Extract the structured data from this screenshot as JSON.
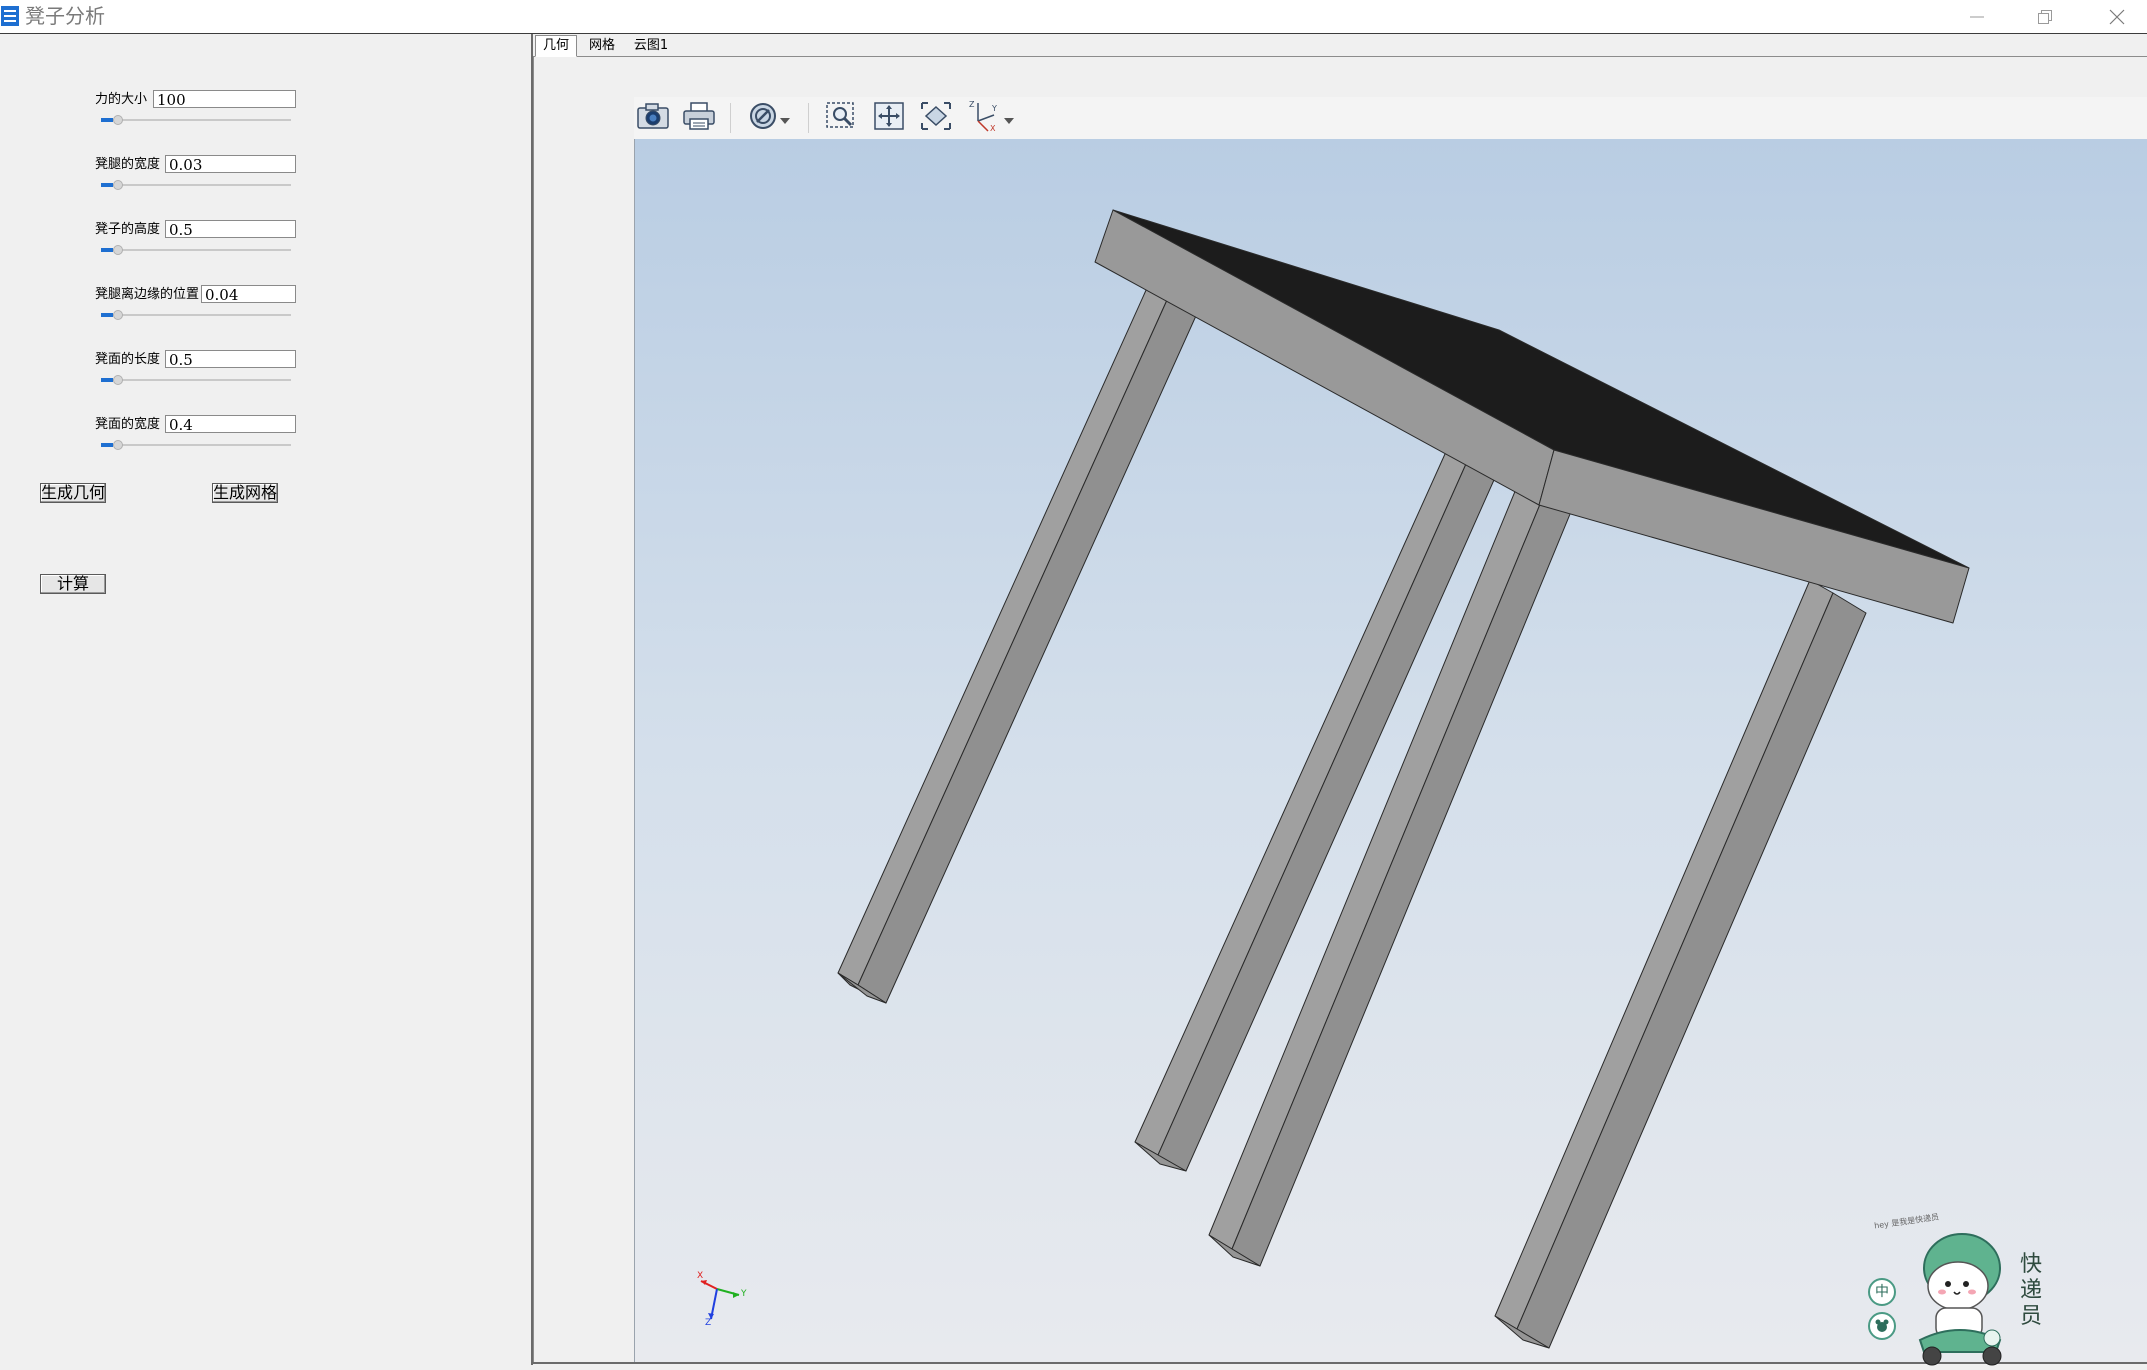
{
  "window": {
    "title": "凳子分析",
    "controls": [
      "minimize-icon",
      "restore-icon",
      "close-icon"
    ]
  },
  "params": [
    {
      "label": "力的大小",
      "value": "100"
    },
    {
      "label": "凳腿的宽度",
      "value": "0.03"
    },
    {
      "label": "凳子的高度",
      "value": "0.5"
    },
    {
      "label": "凳腿离边缘的位置",
      "value": "0.04"
    },
    {
      "label": "凳面的长度",
      "value": "0.5"
    },
    {
      "label": "凳面的宽度",
      "value": "0.4"
    }
  ],
  "buttons": {
    "gen_geometry": "生成几何",
    "gen_mesh": "生成网格",
    "compute": "计算"
  },
  "tabs": [
    {
      "label": "几何",
      "active": true
    },
    {
      "label": "网格",
      "active": false
    },
    {
      "label": "云图1",
      "active": false
    }
  ],
  "toolbar": [
    "camera-icon",
    "print-icon",
    "display-mode-icon",
    "dropdown-arrow-icon",
    "zoom-window-icon",
    "pan-icon",
    "fit-all-icon",
    "axes-view-icon",
    "dropdown-arrow-icon"
  ],
  "axis_triad": {
    "x": "X",
    "y": "Y",
    "z": "Z"
  },
  "colors": {
    "viewport_top": "#b9cde3",
    "viewport_bottom": "#e8eaee",
    "stool_side": "#999999",
    "stool_top": "#1c1c1c",
    "slider_accent": "#1e6fd1"
  },
  "overlay": {
    "side_labels": [
      "中",
      "快",
      "递",
      "员"
    ],
    "mascot_caption": "hey 是我是快递员"
  }
}
